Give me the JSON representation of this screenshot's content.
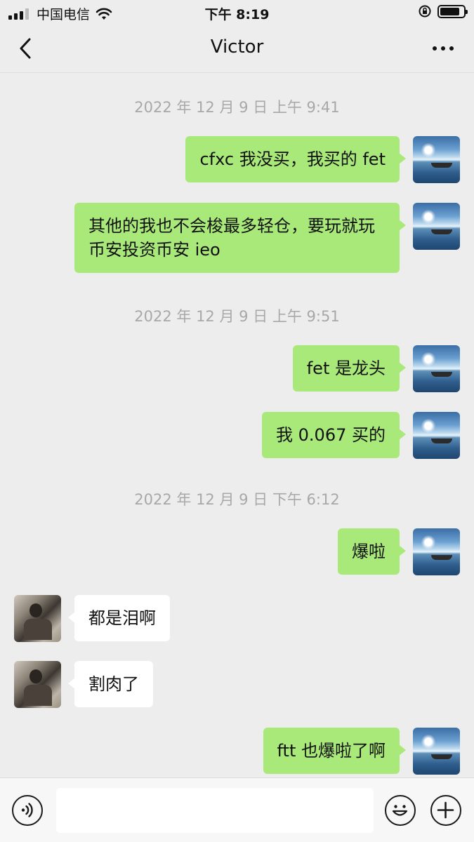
{
  "status_bar": {
    "carrier": "中国电信",
    "time": "下午 8:19"
  },
  "nav": {
    "title": "Victor"
  },
  "messages": [
    {
      "type": "time",
      "text": "2022 年 12 月 9 日 上午 9:41"
    },
    {
      "type": "me",
      "text": "cfxc 我没买，我买的 fet"
    },
    {
      "type": "me",
      "text": "其他的我也不会梭最多轻仓，要玩就玩币安投资币安 ieo"
    },
    {
      "type": "time",
      "text": "2022 年 12 月 9 日 上午 9:51"
    },
    {
      "type": "me",
      "text": "fet 是龙头"
    },
    {
      "type": "me",
      "text": "我 0.067 买的"
    },
    {
      "type": "time",
      "text": "2022 年 12 月 9 日 下午 6:12"
    },
    {
      "type": "me",
      "text": "爆啦"
    },
    {
      "type": "other",
      "text": "都是泪啊"
    },
    {
      "type": "other",
      "text": "割肉了"
    },
    {
      "type": "me",
      "text": "ftt 也爆啦了啊"
    }
  ],
  "input_bar": {
    "value": "",
    "voice_icon": "voice-icon",
    "emoji_icon": "emoji-icon",
    "plus_icon": "plus-icon"
  }
}
